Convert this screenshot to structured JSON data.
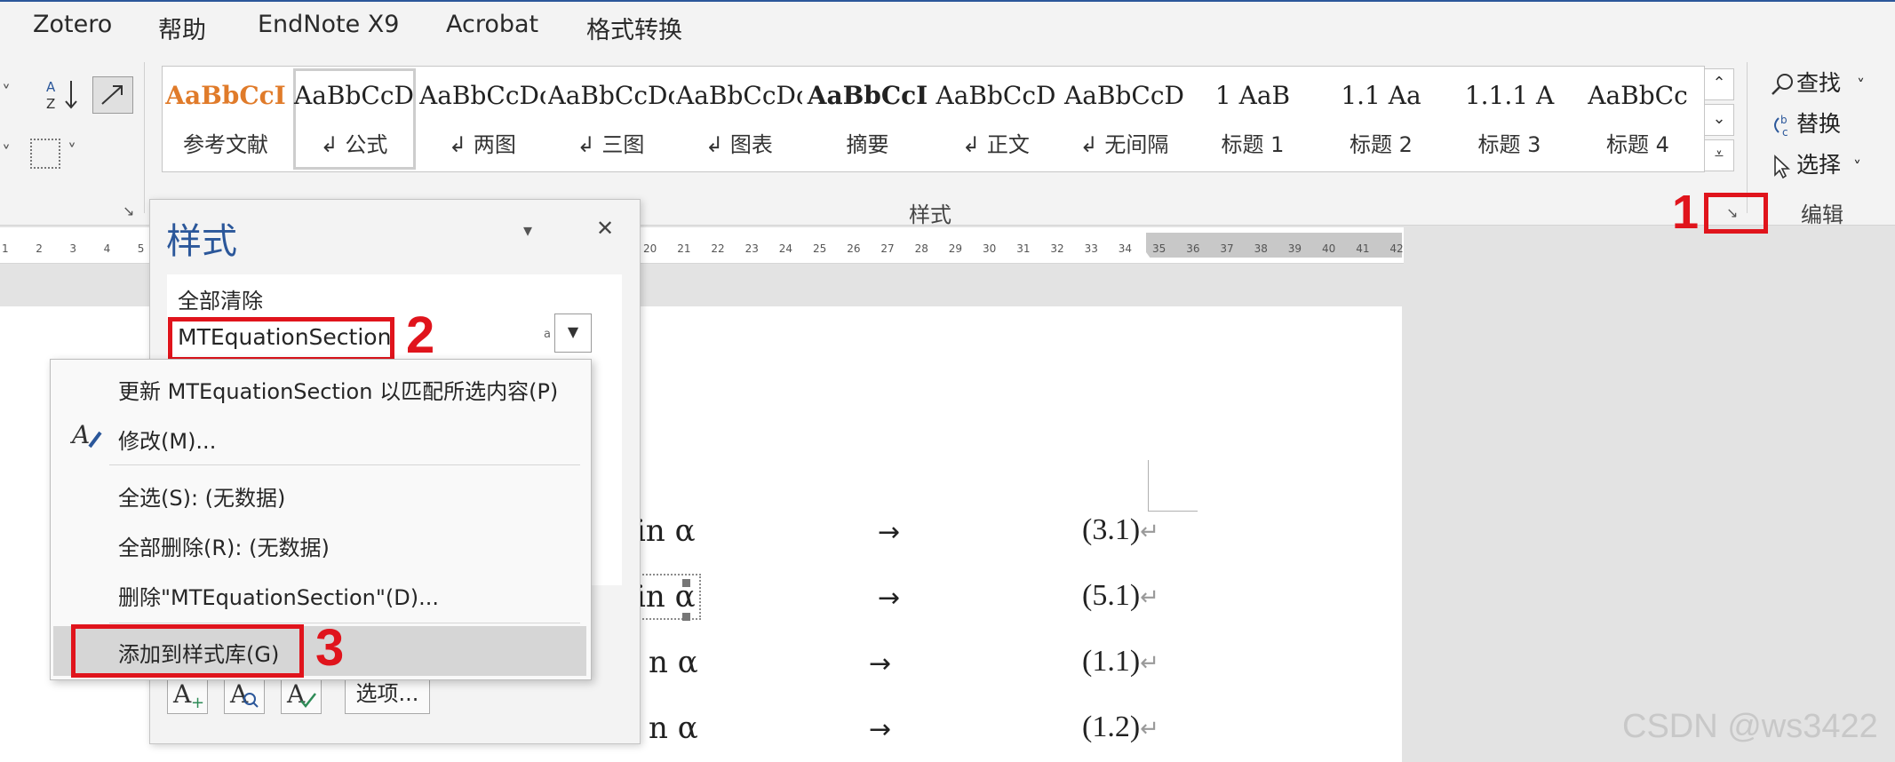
{
  "menu": [
    "Zotero",
    "帮助",
    "EndNote X9",
    "Acrobat",
    "格式转换"
  ],
  "ribbon": {
    "styles_group_label": "样式",
    "edit_group_label": "编辑",
    "gallery": [
      {
        "sample": "AaBbCcI",
        "name": "参考文献",
        "color": "#e07b2a"
      },
      {
        "sample": "AaBbCcD",
        "name": "↲ 公式",
        "selected": true
      },
      {
        "sample": "AaBbCcDc",
        "name": "↲ 两图"
      },
      {
        "sample": "AaBbCcDc",
        "name": "↲ 三图"
      },
      {
        "sample": "AaBbCcDc",
        "name": "↲ 图表"
      },
      {
        "sample": "AaBbCcI",
        "name": "摘要",
        "bold": true
      },
      {
        "sample": "AaBbCcD",
        "name": "↲ 正文"
      },
      {
        "sample": "AaBbCcD",
        "name": "↲ 无间隔"
      },
      {
        "sample": "1   AaB",
        "name": "标题 1"
      },
      {
        "sample": "1.1   Aa",
        "name": "标题 2"
      },
      {
        "sample": "1.1.1   A",
        "name": "标题 3"
      },
      {
        "sample": "AaBbCc",
        "name": "标题 4"
      }
    ],
    "edit": {
      "find": "查找",
      "replace": "替换",
      "select": "选择"
    }
  },
  "ruler_numbers": [
    "1",
    "2",
    "3",
    "4",
    "5",
    "20",
    "21",
    "22",
    "23",
    "24",
    "25",
    "26",
    "27",
    "28",
    "29",
    "30",
    "31",
    "32",
    "33",
    "34",
    "35",
    "36",
    "37",
    "38",
    "39",
    "40",
    "41",
    "42"
  ],
  "styles_pane": {
    "title": "样式",
    "clear_all": "全部清除",
    "selected_style": "MTEquationSection",
    "options_button": "选项..."
  },
  "context_menu": {
    "update": "更新 MTEquationSection 以匹配所选内容(P)",
    "modify": "修改(M)...",
    "select_all": "全选(S): (无数据)",
    "delete_all": "全部删除(R): (无数据)",
    "delete": "删除\"MTEquationSection\"(D)...",
    "add_gallery": "添加到样式库(G)"
  },
  "annotations": {
    "one": "1",
    "two": "2",
    "three": "3",
    "color": "#e0141c"
  },
  "document": {
    "equations": [
      {
        "text": "in α",
        "num": "(3.1)"
      },
      {
        "text": "in α",
        "num": "(5.1)"
      },
      {
        "text": "n α",
        "num": "(1.1)"
      },
      {
        "text": "n α",
        "num": "(1.2)"
      }
    ],
    "arrow": "→",
    "para_mark": "↵"
  },
  "watermark": "CSDN @ws3422"
}
